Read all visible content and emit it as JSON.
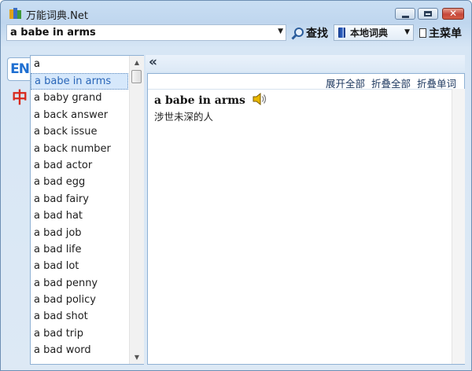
{
  "window": {
    "title": "万能词典.Net"
  },
  "toolbar": {
    "search_value": "a babe in arms",
    "find_label": "查找",
    "dictionary_select": "本地词典",
    "main_menu_label": "主菜单"
  },
  "language_tabs": {
    "en": "EN",
    "zh": "中"
  },
  "word_list": {
    "filter_value": "a",
    "items": [
      "a babe in arms",
      "a baby grand",
      "a back answer",
      "a back issue",
      "a back number",
      "a bad actor",
      "a bad egg",
      "a bad fairy",
      "a bad hat",
      "a bad job",
      "a bad life",
      "a bad lot",
      "a bad penny",
      "a bad policy",
      "a bad shot",
      "a bad trip",
      "a bad word"
    ],
    "selected_index": 0
  },
  "content": {
    "links": {
      "expand_all": "展开全部",
      "collapse_all": "折叠全部",
      "collapse_word": "折叠单词"
    },
    "headword": "a babe in arms",
    "definition": "涉世未深的人"
  },
  "colors": {
    "accent": "#1f6fd1",
    "zh_tab": "#d8281c",
    "selection": "#d6e8fb"
  }
}
